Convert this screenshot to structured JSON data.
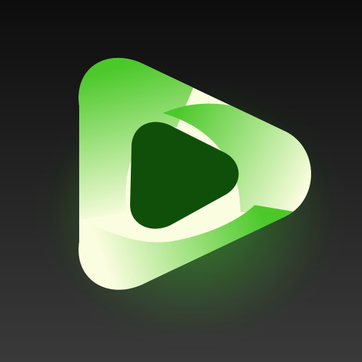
{
  "app_icon": {
    "icon": "rounded-triangle-play-icon",
    "colors": {
      "background_top": "#0d0d0d",
      "background_bottom": "#3a3a3a",
      "pale_cream": "#fbfde0",
      "bright_green": "#4cc82a",
      "dark_green": "#0f4f0a",
      "glow": "#3fd32a"
    }
  }
}
